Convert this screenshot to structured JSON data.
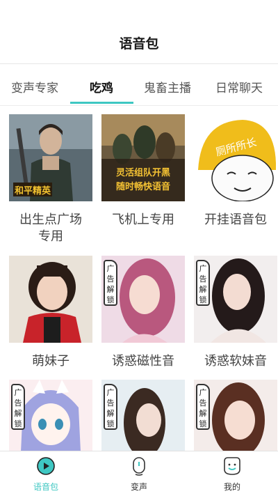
{
  "header": {
    "title": "语音包"
  },
  "tabs": [
    {
      "label": "变声专家"
    },
    {
      "label": "吃鸡",
      "active": true
    },
    {
      "label": "鬼畜主播"
    },
    {
      "label": "日常聊天"
    }
  ],
  "cards": [
    {
      "label_line1": "出生点广场",
      "label_line2": "专用",
      "art_text": "和平精英"
    },
    {
      "label_line1": "飞机上专用",
      "art_text_1": "灵活组队开黑",
      "art_text_2": "随时畅快语音"
    },
    {
      "label_line1": "开挂语音包",
      "art_text": "厕所所长"
    },
    {
      "label_line1": "萌妹子"
    },
    {
      "label_line1": "诱惑磁性音",
      "badge": "广告解锁"
    },
    {
      "label_line1": "诱惑软妹音",
      "badge": "广告解锁"
    },
    {
      "label_line1": "",
      "badge": "广告解锁"
    },
    {
      "label_line1": "",
      "badge": "广告解锁"
    },
    {
      "label_line1": "",
      "badge": "广告解锁"
    }
  ],
  "bottom_nav": [
    {
      "label": "语音包",
      "icon": "play-circle-icon",
      "active": true
    },
    {
      "label": "变声",
      "icon": "microphone-icon"
    },
    {
      "label": "我的",
      "icon": "smiley-face-icon"
    }
  ],
  "colors": {
    "accent": "#3ec7c2",
    "tab_text": "#555555",
    "label_text": "#444444"
  }
}
